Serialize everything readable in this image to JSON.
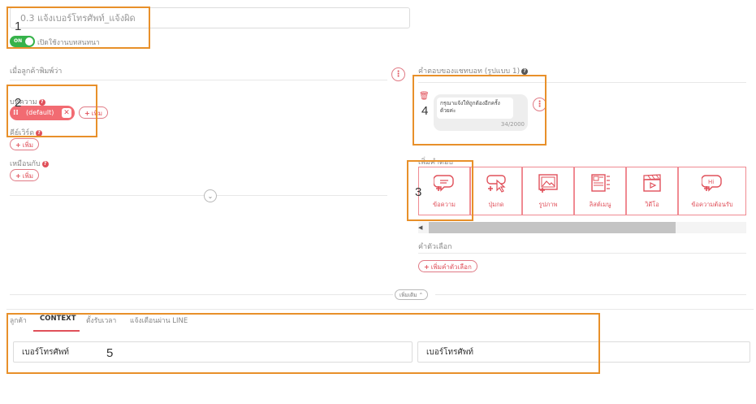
{
  "flow": {
    "title_value": "0.3 แจ้งเบอร์โทรศัพท์_แจ้งผิด",
    "toggle_on_label": "ON",
    "toggle_caption": "เปิดใช้งานบทสนทนา"
  },
  "left": {
    "when_user_types_label": "เมื่อลูกค้าพิมพ์ว่า",
    "keyword_label": "บทความ",
    "keyword_chip": "(default)",
    "add_label": "เพิ่ม",
    "keyword2_label": "คีย์เวิร์ด",
    "similar_label": "เหมือนกับ"
  },
  "right": {
    "bot_reply_label": "คำตอบของแชทบอท (รูปแบบ 1)",
    "reply_text": "กรุณาแจ้งให้ถูกต้องอีกครั้ง ด้วยค่ะ",
    "char_counter": "34/2000",
    "add_response_label": "เพิ่มคำตอบ",
    "tiles": [
      {
        "label": "ข้อความ",
        "icon": "message-icon"
      },
      {
        "label": "ปุ่มกด",
        "icon": "button-cursor-icon"
      },
      {
        "label": "รูปภาพ",
        "icon": "image-icon"
      },
      {
        "label": "ลิสต์เมนู",
        "icon": "list-menu-icon"
      },
      {
        "label": "วิดีโอ",
        "icon": "video-icon"
      },
      {
        "label": "ข้อความต้อนรับ",
        "icon": "greeting-icon"
      }
    ],
    "quick_reply_label": "คำตัวเลือก",
    "add_quick_reply_label": "เพิ่มคำตัวเลือก"
  },
  "more_button": "เพิ่มเติม",
  "bottom": {
    "tabs": [
      "ลูกค้า",
      "CONTEXT",
      "ตั้งรับเวลา",
      "แจ้งเตือนผ่าน LINE"
    ],
    "active_tab": "CONTEXT",
    "field1_value": "เบอร์โทรศัพท์",
    "field2_value": "เบอร์โทรศัพท์"
  },
  "annotations": [
    "1",
    "2",
    "3",
    "4",
    "5"
  ],
  "colors": {
    "accent": "#e0505a",
    "toggle_green": "#36b24a",
    "annotation_orange": "#e8902a"
  }
}
